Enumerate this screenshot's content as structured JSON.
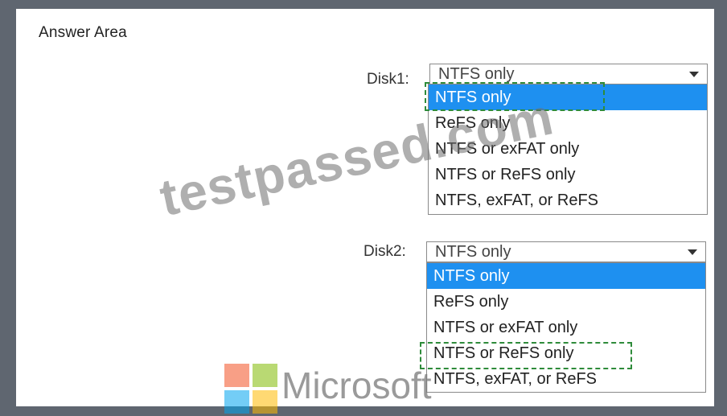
{
  "answer_area": {
    "title": "Answer Area"
  },
  "disk1": {
    "label": "Disk1:",
    "selected_value": "NTFS only",
    "options": [
      "NTFS only",
      "ReFS only",
      "NTFS or exFAT only",
      "NTFS or ReFS only",
      "NTFS, exFAT, or ReFS"
    ],
    "highlighted_option": "NTFS only",
    "marked_answer": "NTFS only"
  },
  "disk2": {
    "label": "Disk2:",
    "selected_value": "NTFS only",
    "options": [
      "NTFS only",
      "ReFS only",
      "NTFS or exFAT only",
      "NTFS or ReFS only",
      "NTFS, exFAT, or ReFS"
    ],
    "highlighted_option": "NTFS only",
    "marked_answer": "NTFS or ReFS only"
  },
  "watermark": {
    "text": "testpassed.com"
  },
  "microsoft_logo": {
    "text": "Microsoft",
    "colors": [
      "#f25022",
      "#7fba00",
      "#00a4ef",
      "#ffb900"
    ]
  },
  "colors": {
    "selection_highlight": "#1e90f0",
    "answer_marker": "#2e8b3a",
    "frame": "#5f6670"
  }
}
